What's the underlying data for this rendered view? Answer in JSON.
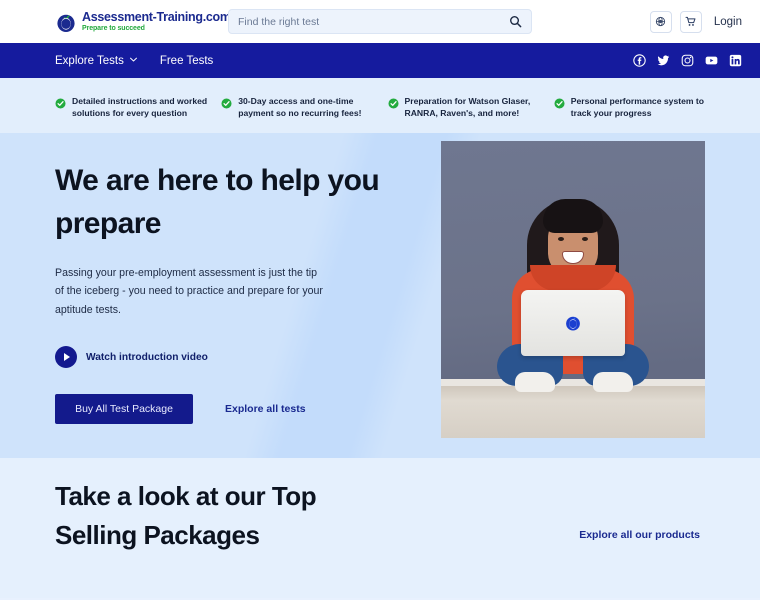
{
  "header": {
    "logo": {
      "title": "Assessment-Training.com",
      "tagline": "Prepare to succeed",
      "icon": "apple-blueberry-logo-icon"
    },
    "search": {
      "placeholder": "Find the right test",
      "value": "",
      "icon": "search-icon"
    },
    "language_icon": "globe-icon",
    "cart_icon": "shopping-cart-icon",
    "login_label": "Login"
  },
  "nav": {
    "items": [
      {
        "label": "Explore Tests",
        "has_dropdown": true,
        "chevron": "chevron-down-icon"
      },
      {
        "label": "Free Tests",
        "has_dropdown": false
      }
    ],
    "social": [
      {
        "name": "facebook-icon",
        "label": "Facebook"
      },
      {
        "name": "twitter-icon",
        "label": "Twitter"
      },
      {
        "name": "instagram-icon",
        "label": "Instagram"
      },
      {
        "name": "youtube-icon",
        "label": "YouTube"
      },
      {
        "name": "linkedin-icon",
        "label": "LinkedIn"
      }
    ],
    "background_color": "#151b9e"
  },
  "features": [
    {
      "text": "Detailed instructions and worked solutions for every question",
      "icon": "check-circle-icon"
    },
    {
      "text": "30-Day access and one-time payment so no recurring fees!",
      "icon": "check-circle-icon"
    },
    {
      "text": "Preparation for Watson Glaser, RANRA, Raven's, and more!",
      "icon": "check-circle-icon"
    },
    {
      "text": "Personal performance system to track your progress",
      "icon": "check-circle-icon"
    }
  ],
  "hero": {
    "title": "We are here to help you prepare",
    "subtitle": "Passing your pre-employment assessment is just the tip of the iceberg - you need to practice and prepare for your aptitude tests.",
    "watch_video_label": "Watch introduction video",
    "watch_video_icon": "play-circle-icon",
    "buy_button_label": "Buy All Test Package",
    "explore_link_label": "Explore all tests",
    "image_alt": "Smiling woman in orange hoodie sitting cross-legged on floor with a white laptop"
  },
  "bottom": {
    "title": "Take a look at our Top Selling Packages",
    "link_label": "Explore all our products"
  },
  "colors": {
    "brand_navy": "#151b9e",
    "brand_green": "#22a93c",
    "hero_bg": "#cfe3fb",
    "feature_bg": "#e2eefc",
    "bottom_bg": "#e5f0fd",
    "accent_orange": "#e04f30"
  }
}
